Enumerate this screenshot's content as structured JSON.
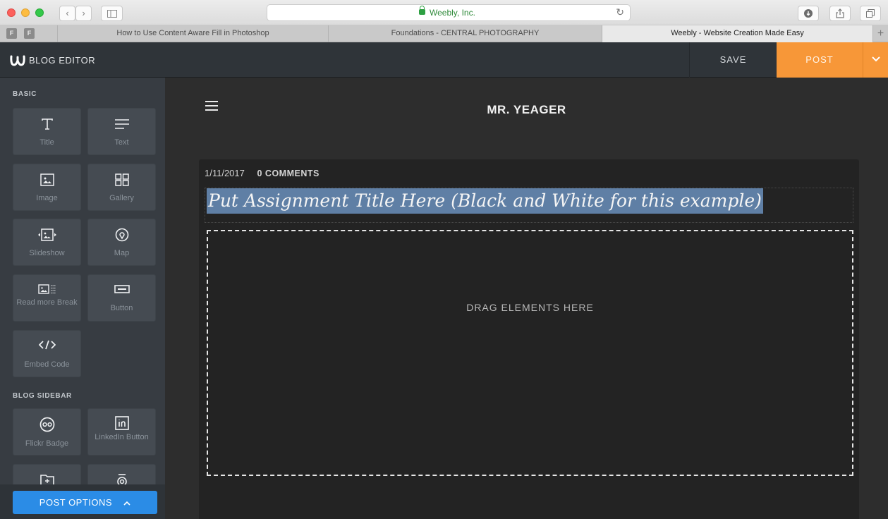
{
  "browser": {
    "url": "Weebly, Inc.",
    "tabs": [
      {
        "label": "How to Use Content Aware Fill in Photoshop",
        "active": false
      },
      {
        "label": "Foundations - CENTRAL PHOTOGRAPHY",
        "active": false
      },
      {
        "label": "Weebly - Website Creation Made Easy",
        "active": true
      }
    ],
    "favicon_letter": "F",
    "new_tab_glyph": "+"
  },
  "editor": {
    "app_title": "BLOG EDITOR",
    "save_label": "SAVE",
    "post_label": "POST",
    "accent_color": "#f79738"
  },
  "sidebar": {
    "basic_label": "BASIC",
    "blog_sidebar_label": "BLOG SIDEBAR",
    "basic_items": [
      {
        "label": "Title",
        "icon": "title-icon"
      },
      {
        "label": "Text",
        "icon": "text-icon"
      },
      {
        "label": "Image",
        "icon": "image-icon"
      },
      {
        "label": "Gallery",
        "icon": "gallery-icon"
      },
      {
        "label": "Slideshow",
        "icon": "slideshow-icon"
      },
      {
        "label": "Map",
        "icon": "map-pin-icon"
      },
      {
        "label": "Read more Break",
        "icon": "read-more-icon"
      },
      {
        "label": "Button",
        "icon": "button-icon"
      },
      {
        "label": "Embed Code",
        "icon": "code-icon"
      }
    ],
    "blog_items": [
      {
        "label": "Flickr Badge",
        "icon": "flickr-icon"
      },
      {
        "label": "LinkedIn Button",
        "icon": "linkedin-icon"
      }
    ],
    "post_options_label": "POST OPTIONS"
  },
  "canvas": {
    "site_title": "MR. YEAGER",
    "post_date": "1/11/2017",
    "comments": "0 COMMENTS",
    "post_title": "Put Assignment Title Here (Black and White for this example)",
    "drop_text": "DRAG ELEMENTS HERE"
  }
}
